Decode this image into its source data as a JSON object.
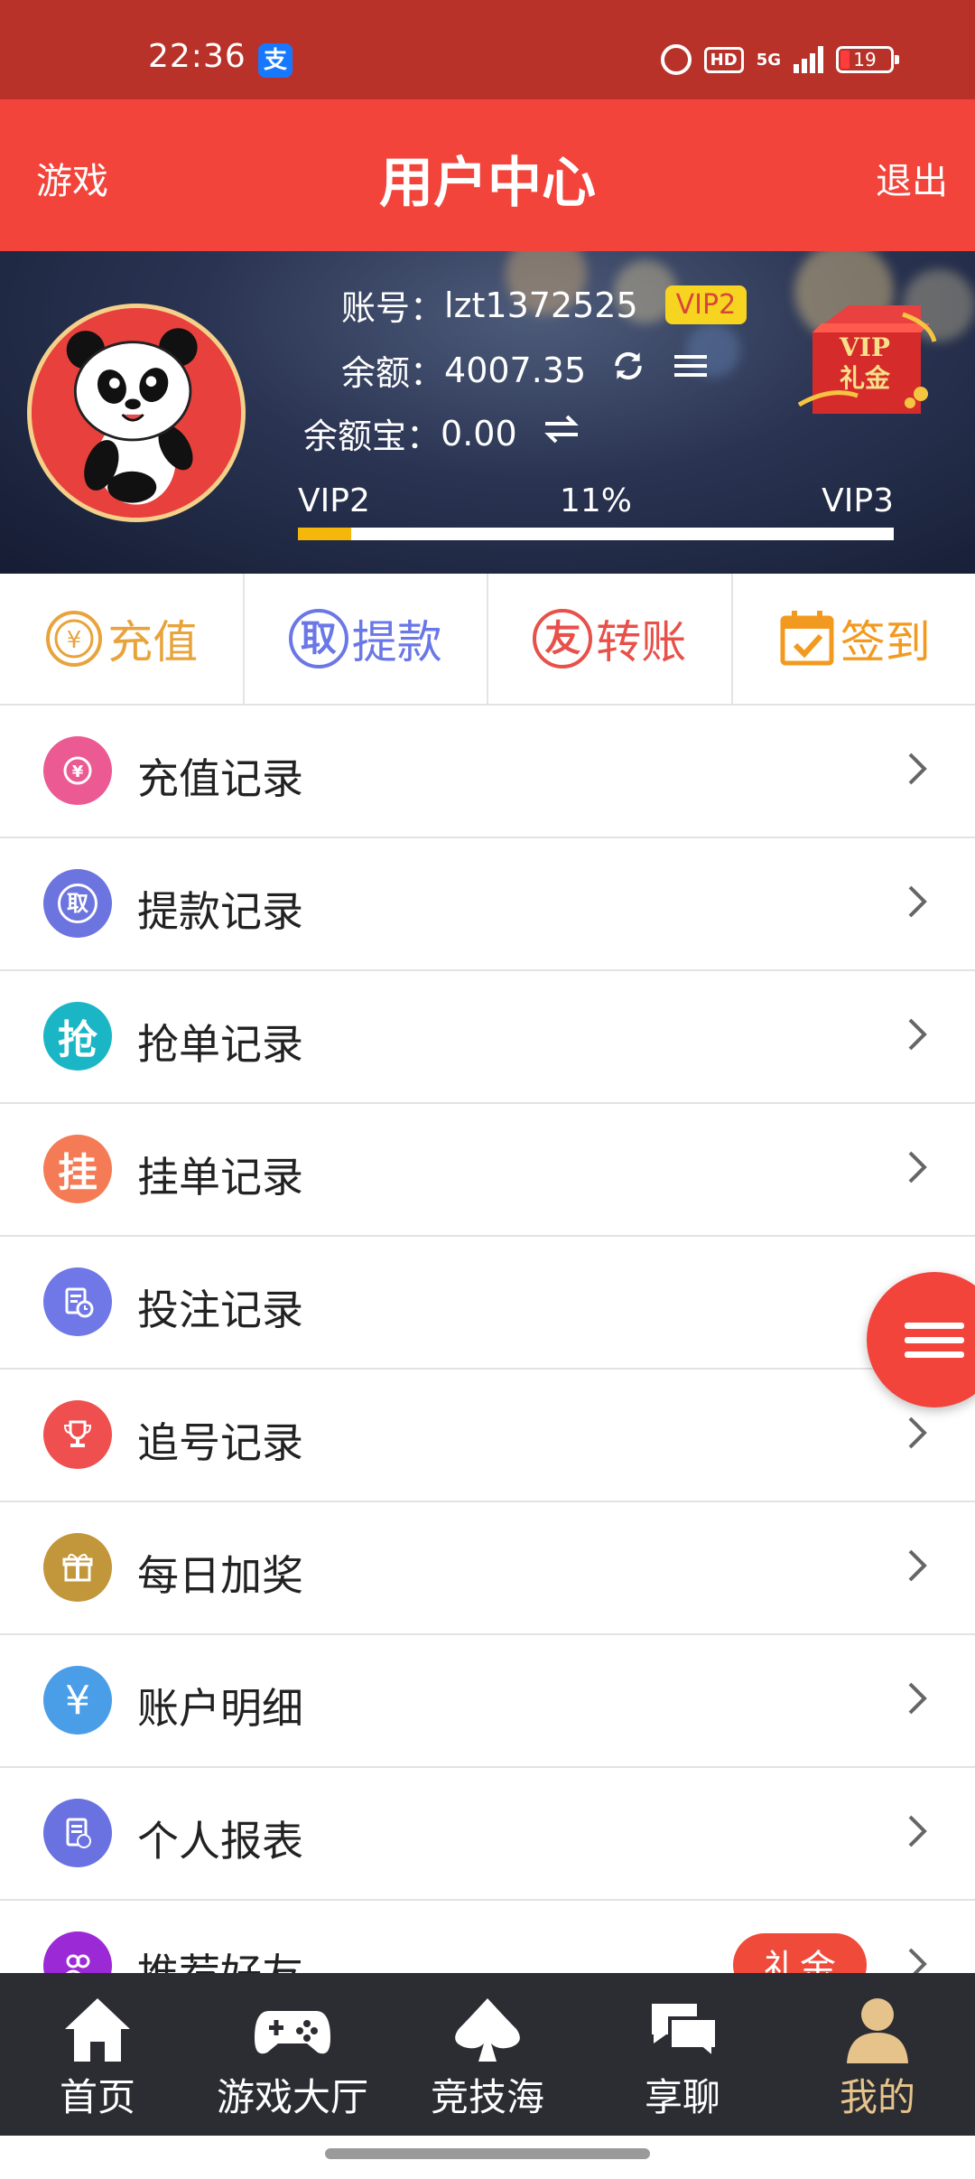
{
  "status_bar": {
    "time": "22:36",
    "alipay_glyph": "支",
    "network": "5G",
    "hd": "HD",
    "battery": "19"
  },
  "header": {
    "left_link": "游戏",
    "title": "用户中心",
    "right_link": "退出"
  },
  "profile": {
    "account_label": "账号：",
    "account": "lzt1372525",
    "vip_badge": "VIP2",
    "balance_label": "余额：",
    "balance": "4007.35",
    "yuebao_label": "余额宝：",
    "yuebao": "0.00",
    "gift_line1": "VIP",
    "gift_line2": "礼金"
  },
  "vip_progress": {
    "current": "VIP2",
    "percent_text": "11%",
    "next": "VIP3",
    "fraction": 0.05
  },
  "actions": [
    {
      "label": "充值",
      "color": "#e8a33b",
      "icon": "yuan-coin-icon"
    },
    {
      "label": "提款",
      "color": "#6a77e6",
      "icon": "withdraw-icon",
      "glyph": "取"
    },
    {
      "label": "转账",
      "color": "#e8504a",
      "icon": "transfer-icon",
      "glyph": "友"
    },
    {
      "label": "签到",
      "color": "#f29a1f",
      "icon": "calendar-check-icon"
    }
  ],
  "menu": [
    {
      "label": "充值记录",
      "color": "#ec5a93",
      "icon": "recharge-record-icon"
    },
    {
      "label": "提款记录",
      "color": "#6c74e0",
      "icon": "withdraw-record-icon"
    },
    {
      "label": "抢单记录",
      "color": "#1bb6c6",
      "icon": "grab-order-icon",
      "glyph": "抢"
    },
    {
      "label": "挂单记录",
      "color": "#f47b55",
      "icon": "pending-order-icon",
      "glyph": "挂"
    },
    {
      "label": "投注记录",
      "color": "#6f78e6",
      "icon": "bet-record-icon"
    },
    {
      "label": "追号记录",
      "color": "#ef4f4f",
      "icon": "trophy-icon"
    },
    {
      "label": "每日加奖",
      "color": "#c2963a",
      "icon": "gift-icon"
    },
    {
      "label": "账户明细",
      "color": "#4a9ee8",
      "icon": "yuan-icon",
      "glyph": "¥"
    },
    {
      "label": "个人报表",
      "color": "#6972e0",
      "icon": "report-icon"
    },
    {
      "label": "推荐好友",
      "color": "#9b2ad6",
      "icon": "friends-icon",
      "badge": "礼金"
    }
  ],
  "bottom_nav": [
    {
      "label": "首页",
      "icon": "home-icon"
    },
    {
      "label": "游戏大厅",
      "icon": "gamepad-icon"
    },
    {
      "label": "竞技海",
      "icon": "spade-icon"
    },
    {
      "label": "享聊",
      "icon": "chat-icon"
    },
    {
      "label": "我的",
      "icon": "user-icon",
      "active": true
    }
  ]
}
